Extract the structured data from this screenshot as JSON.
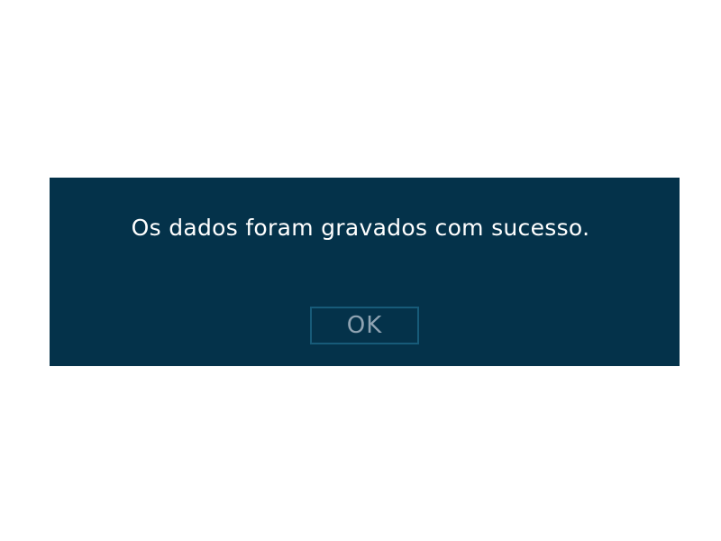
{
  "dialog": {
    "message": "Os dados foram gravados com sucesso.",
    "ok_label": "OK"
  }
}
